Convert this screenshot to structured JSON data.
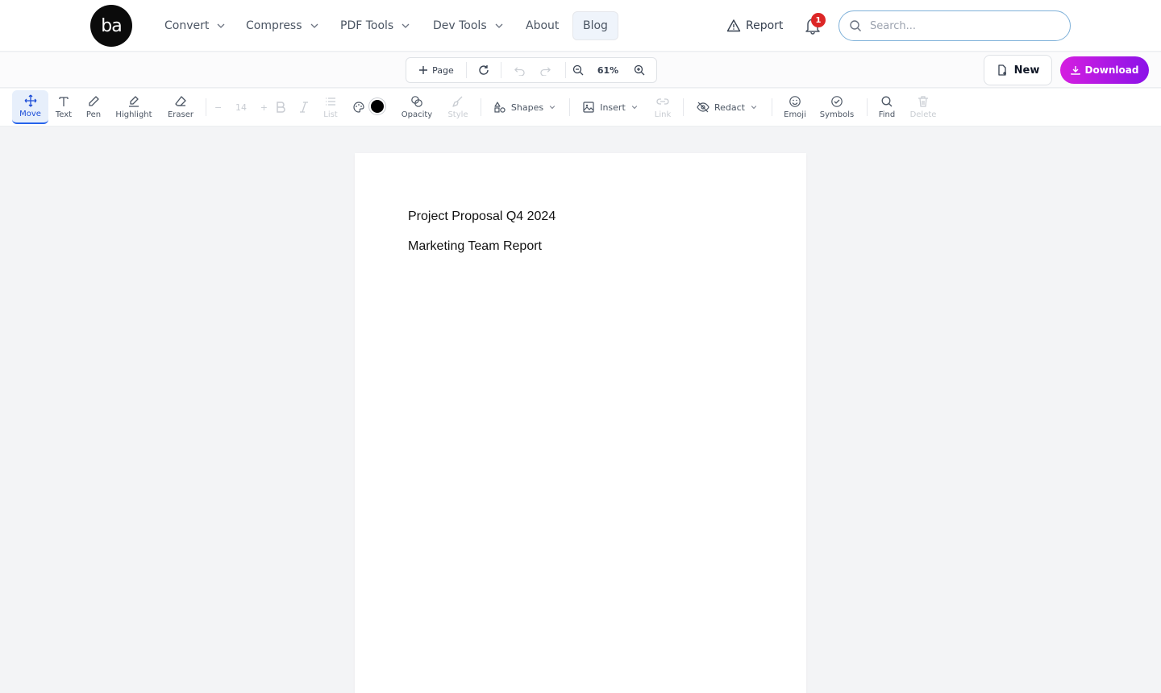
{
  "nav": {
    "logo_text": "ba",
    "links": [
      {
        "label": "Convert",
        "dropdown": true
      },
      {
        "label": "Compress",
        "dropdown": true
      },
      {
        "label": "PDF Tools",
        "dropdown": true
      },
      {
        "label": "Dev Tools",
        "dropdown": true
      },
      {
        "label": "About",
        "dropdown": false
      },
      {
        "label": "Blog",
        "dropdown": false,
        "active": true
      }
    ],
    "report_label": "Report",
    "notification_count": "1",
    "search_placeholder": "Search..."
  },
  "page_toolbar": {
    "add_page_label": "Page",
    "zoom_level": "61%",
    "new_label": "New",
    "download_label": "Download"
  },
  "edit_toolbar": {
    "tools": [
      {
        "label": "Move",
        "icon": "move-icon",
        "active": true
      },
      {
        "label": "Text",
        "icon": "text-icon"
      },
      {
        "label": "Pen",
        "icon": "pen-icon"
      },
      {
        "label": "Highlight",
        "icon": "highlight-icon"
      },
      {
        "label": "Eraser",
        "icon": "eraser-icon"
      }
    ],
    "font_size": "14",
    "list_label": "List",
    "current_color": "#000000",
    "opacity_label": "Opacity",
    "style_label": "Style",
    "shapes_label": "Shapes",
    "insert_label": "Insert",
    "link_label": "Link",
    "redact_label": "Redact",
    "emoji_label": "Emoji",
    "symbols_label": "Symbols",
    "find_label": "Find",
    "delete_label": "Delete"
  },
  "document": {
    "lines": [
      "Project Proposal Q4 2024",
      "Marketing Team Report"
    ]
  },
  "colors": {
    "accent": "#2563eb",
    "download_gradient_start": "#d51fe0",
    "download_gradient_end": "#8b12e8",
    "badge": "#dc2626"
  }
}
